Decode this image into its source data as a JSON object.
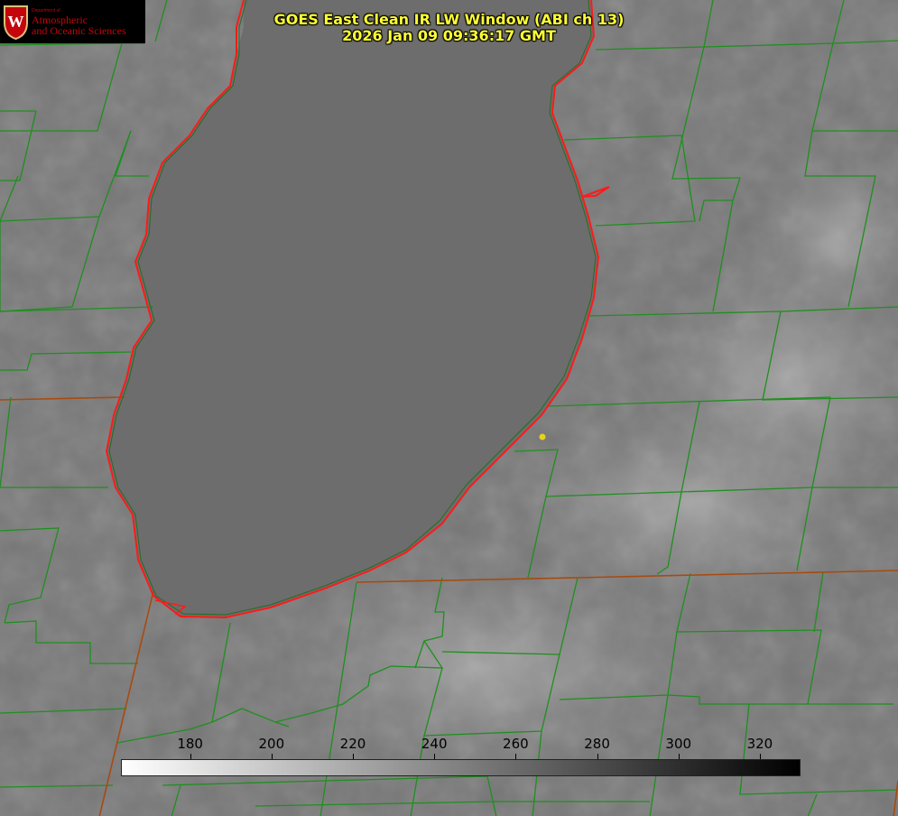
{
  "title": {
    "line1": "GOES East Clean IR LW Window (ABI ch 13)",
    "line2": "2026 Jan 09 09:36:17 GMT"
  },
  "logo": {
    "dept": "Department of",
    "line1": "Atmospheric",
    "line2": "and Oceanic Sciences",
    "crest_letter": "W",
    "color": "#c5050c"
  },
  "colorbar": {
    "min": 163,
    "max": 330,
    "ticks": [
      "180",
      "200",
      "220",
      "240",
      "260",
      "280",
      "300",
      "320"
    ],
    "start_color": "#ffffff",
    "end_color": "#000000"
  },
  "colors": {
    "county_lines": "#1f8f1f",
    "state_lines": "#b34700",
    "coastline": "#ff1a1a",
    "lake": "#6e6e6e",
    "land": "#7a7a7a",
    "point_marker": "#e6d21a",
    "title": "#ffff33"
  }
}
